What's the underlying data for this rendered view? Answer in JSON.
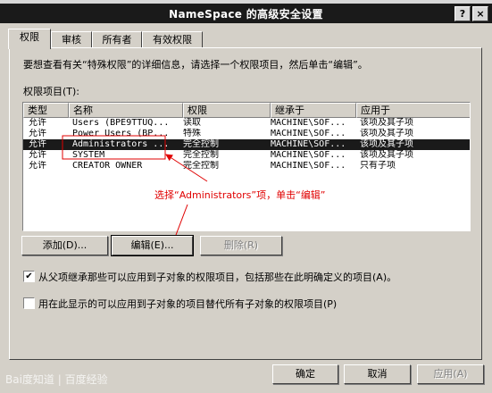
{
  "window": {
    "title": "NameSpace 的高级安全设置",
    "help_btn": "?",
    "close_btn": "×"
  },
  "tabs": [
    {
      "label": "权限"
    },
    {
      "label": "审核"
    },
    {
      "label": "所有者"
    },
    {
      "label": "有效权限"
    }
  ],
  "instruction": "要想查看有关“特殊权限”的详细信息，请选择一个权限项目，然后单击“编辑”。",
  "list_label": "权限项目(T):",
  "columns": [
    "类型",
    "名称",
    "权限",
    "继承于",
    "应用于"
  ],
  "rows": [
    {
      "type": "允许",
      "name": "Users (BPE9TTUQ...",
      "perm": "读取",
      "inherit": "MACHINE\\SOF...",
      "apply": "该项及其子项"
    },
    {
      "type": "允许",
      "name": "Power Users (BP...",
      "perm": "特殊",
      "inherit": "MACHINE\\SOF...",
      "apply": "该项及其子项"
    },
    {
      "type": "允许",
      "name": "Administrators ...",
      "perm": "完全控制",
      "inherit": "MACHINE\\SOF...",
      "apply": "该项及其子项"
    },
    {
      "type": "允许",
      "name": "SYSTEM",
      "perm": "完全控制",
      "inherit": "MACHINE\\SOF...",
      "apply": "该项及其子项"
    },
    {
      "type": "允许",
      "name": "CREATOR OWNER",
      "perm": "完全控制",
      "inherit": "MACHINE\\SOF...",
      "apply": "只有子项"
    }
  ],
  "annotation": "选择“Administrators”项，单击“编辑”",
  "buttons": {
    "add": "添加(D)...",
    "edit": "编辑(E)...",
    "remove": "删除(R)"
  },
  "checkbox_inherit": {
    "label": "从父项继承那些可以应用到子对象的权限项目，包括那些在此明确定义的项目(A)。",
    "mark": "✔"
  },
  "checkbox_replace": {
    "label": "用在此显示的可以应用到子对象的项目替代所有子对象的权限项目(P)"
  },
  "footer": {
    "ok": "确定",
    "cancel": "取消",
    "apply": "应用(A)"
  },
  "watermark": "Bai度知道 | 百度经验"
}
